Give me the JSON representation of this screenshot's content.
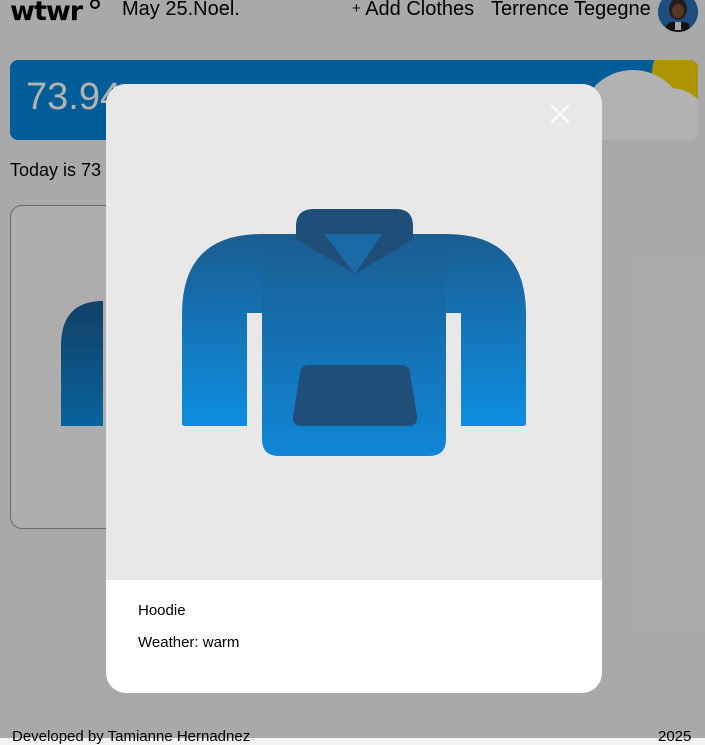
{
  "header": {
    "logo": "wtwr",
    "date": "May 25.Noel.",
    "add_clothes_plus": "+",
    "add_clothes_label": "Add Clothes",
    "username": "Terrence Tegegne"
  },
  "weather": {
    "temperature": "73.94",
    "today_text": "Today is 73"
  },
  "modal": {
    "item_name": "Hoodie",
    "weather_label": "Weather: warm",
    "item_icon": "hoodie-icon"
  },
  "footer": {
    "credit": "Developed by Tamianne Hernadnez",
    "year": "2025"
  },
  "colors": {
    "weather_card": "#0086d9",
    "hoodie_gradient_top": "#1a5d91",
    "hoodie_gradient_bottom": "#0d8ee0",
    "hoodie_pocket": "#1f4f78"
  }
}
